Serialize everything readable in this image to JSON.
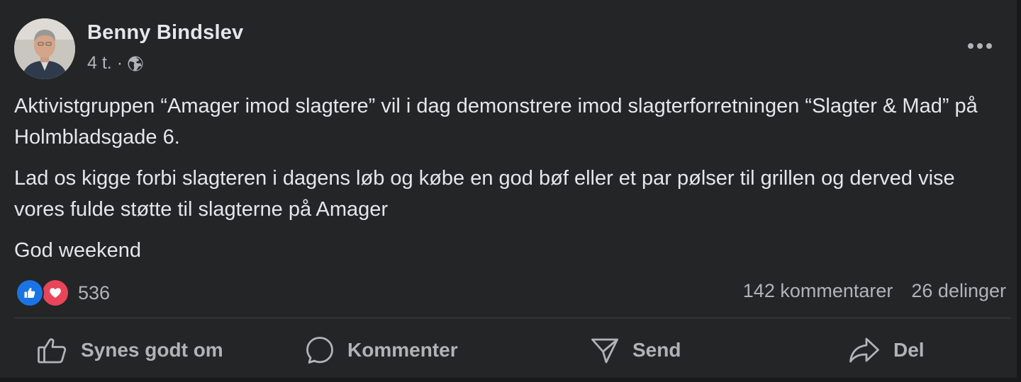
{
  "post": {
    "author": "Benny Bindslev",
    "time": "4 t.",
    "separator": "·",
    "privacy_icon": "globe-icon",
    "paragraphs": [
      "Aktivistgruppen “Amager imod slagtere” vil i dag demonstrere imod slagterforretningen “Slagter & Mad” på Holmbladsgade 6.",
      "Lad os kigge forbi slagteren i dagens løb og købe en god bøf eller et par pølser til grillen og derved vise vores fulde støtte til slagterne på Amager",
      "God weekend"
    ]
  },
  "stats": {
    "reaction_icons": [
      "like-icon",
      "love-icon"
    ],
    "reactions_count": "536",
    "comments": "142 kommentarer",
    "shares": "26 delinger"
  },
  "actions": {
    "like": "Synes godt om",
    "comment": "Kommenter",
    "send": "Send",
    "share": "Del"
  },
  "colors": {
    "card_bg": "#242526",
    "text": "#e4e6eb",
    "secondary_text": "#b0b3b8",
    "like_blue": "#1b74e4",
    "love_red": "#e8455a"
  }
}
